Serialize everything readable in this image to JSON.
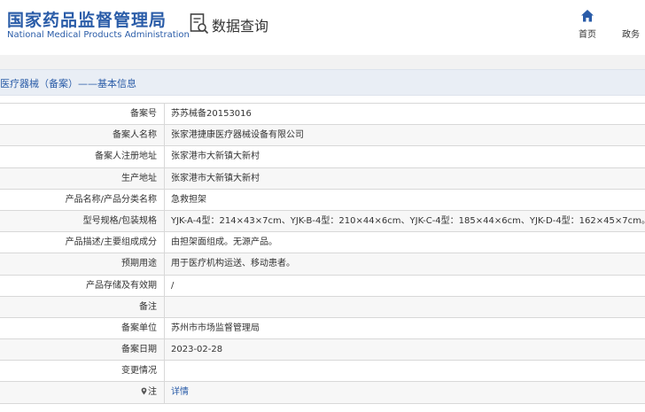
{
  "header": {
    "logo_cn": "国家药品监督管理局",
    "logo_en": "National Medical Products Administration",
    "query_title": "数据查询",
    "nav": {
      "home": "首页",
      "gov": "政务"
    }
  },
  "section_title": "医疗器械（备案）——基本信息",
  "rows": [
    {
      "label": "备案号",
      "value": "苏苏械备20153016"
    },
    {
      "label": "备案人名称",
      "value": "张家港捷康医疗器械设备有限公司"
    },
    {
      "label": "备案人注册地址",
      "value": "张家港市大新镇大新村"
    },
    {
      "label": "生产地址",
      "value": "张家港市大新镇大新村"
    },
    {
      "label": "产品名称/产品分类名称",
      "value": "急救担架"
    },
    {
      "label": "型号规格/包装规格",
      "value": "YJK-A-4型：214×43×7cm、YJK-B-4型：210×44×6cm、YJK-C-4型：185×44×6cm、YJK-D-4型：162×45×7cm。"
    },
    {
      "label": "产品描述/主要组成成分",
      "value": "由担架面组成。无源产品。"
    },
    {
      "label": "预期用途",
      "value": "用于医疗机构运送、移动患者。"
    },
    {
      "label": "产品存储及有效期",
      "value": "/"
    },
    {
      "label": "备注",
      "value": ""
    },
    {
      "label": "备案单位",
      "value": "苏州市市场监督管理局"
    },
    {
      "label": "备案日期",
      "value": "2023-02-28"
    },
    {
      "label": "变更情况",
      "value": ""
    },
    {
      "label": "注",
      "value": "详情"
    }
  ],
  "colors": {
    "brand": "#2a5ca8",
    "link": "#2a5ca8"
  },
  "icons": {
    "query": "search-document-icon",
    "home": "home-icon",
    "note": "pin-icon"
  }
}
